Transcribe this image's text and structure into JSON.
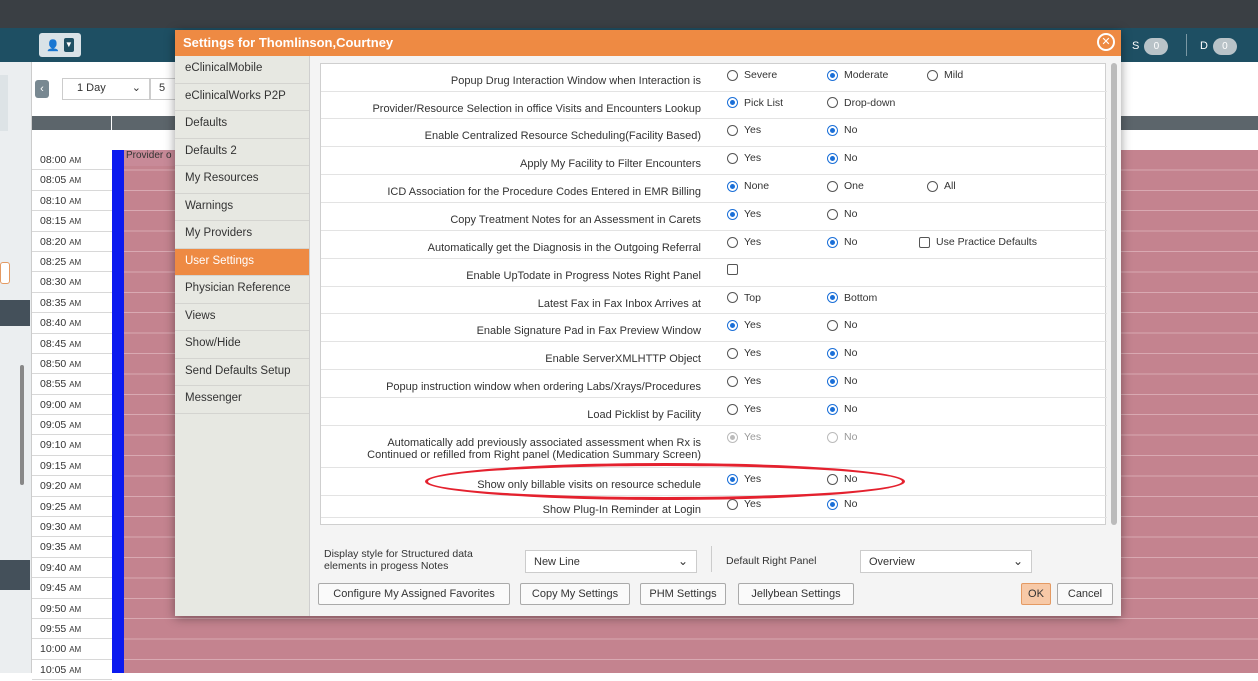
{
  "app": {
    "counters": [
      {
        "label": "S",
        "count": "0"
      },
      {
        "label": "D",
        "count": "0"
      }
    ]
  },
  "schedule": {
    "view": "1 Day",
    "view_count": "5",
    "provider_stub": "Provider o",
    "times": [
      {
        "t": "08:00",
        "p": "AM"
      },
      {
        "t": "08:05",
        "p": "AM"
      },
      {
        "t": "08:10",
        "p": "AM"
      },
      {
        "t": "08:15",
        "p": "AM"
      },
      {
        "t": "08:20",
        "p": "AM"
      },
      {
        "t": "08:25",
        "p": "AM"
      },
      {
        "t": "08:30",
        "p": "AM"
      },
      {
        "t": "08:35",
        "p": "AM"
      },
      {
        "t": "08:40",
        "p": "AM"
      },
      {
        "t": "08:45",
        "p": "AM"
      },
      {
        "t": "08:50",
        "p": "AM"
      },
      {
        "t": "08:55",
        "p": "AM"
      },
      {
        "t": "09:00",
        "p": "AM"
      },
      {
        "t": "09:05",
        "p": "AM"
      },
      {
        "t": "09:10",
        "p": "AM"
      },
      {
        "t": "09:15",
        "p": "AM"
      },
      {
        "t": "09:20",
        "p": "AM"
      },
      {
        "t": "09:25",
        "p": "AM"
      },
      {
        "t": "09:30",
        "p": "AM"
      },
      {
        "t": "09:35",
        "p": "AM"
      },
      {
        "t": "09:40",
        "p": "AM"
      },
      {
        "t": "09:45",
        "p": "AM"
      },
      {
        "t": "09:50",
        "p": "AM"
      },
      {
        "t": "09:55",
        "p": "AM"
      },
      {
        "t": "10:00",
        "p": "AM"
      },
      {
        "t": "10:05",
        "p": "AM"
      }
    ]
  },
  "modal": {
    "title": "Settings for Thomlinson,Courtney",
    "nav": [
      {
        "label": "eClinicalMobile",
        "active": false
      },
      {
        "label": "eClinicalWorks P2P",
        "active": false
      },
      {
        "label": "Defaults",
        "active": false
      },
      {
        "label": "Defaults 2",
        "active": false
      },
      {
        "label": "My Resources",
        "active": false
      },
      {
        "label": "Warnings",
        "active": false
      },
      {
        "label": "My Providers",
        "active": false
      },
      {
        "label": "User Settings",
        "active": true
      },
      {
        "label": "Physician Reference",
        "active": false
      },
      {
        "label": "Views",
        "active": false
      },
      {
        "label": "Show/Hide",
        "active": false
      },
      {
        "label": "Send Defaults Setup",
        "active": false
      },
      {
        "label": "Messenger",
        "active": false
      }
    ],
    "settings": [
      {
        "label": "Popup Drug Interaction Window when Interaction is",
        "options": [
          {
            "label": "Severe",
            "checked": false
          },
          {
            "label": "Moderate",
            "checked": true
          },
          {
            "label": "Mild",
            "checked": false
          }
        ]
      },
      {
        "label": "Provider/Resource Selection in office Visits and Encounters Lookup",
        "options": [
          {
            "label": "Pick List",
            "checked": true
          },
          {
            "label": "Drop-down",
            "checked": false
          }
        ]
      },
      {
        "label": "Enable Centralized Resource Scheduling(Facility Based)",
        "options": [
          {
            "label": "Yes",
            "checked": false
          },
          {
            "label": "No",
            "checked": true
          }
        ]
      },
      {
        "label": "Apply My Facility to Filter Encounters",
        "options": [
          {
            "label": "Yes",
            "checked": false
          },
          {
            "label": "No",
            "checked": true
          }
        ]
      },
      {
        "label": "ICD Association for the Procedure Codes Entered in EMR Billing",
        "options": [
          {
            "label": "None",
            "checked": true
          },
          {
            "label": "One",
            "checked": false
          },
          {
            "label": "All",
            "checked": false
          }
        ]
      },
      {
        "label": "Copy Treatment Notes for an Assessment in Carets",
        "options": [
          {
            "label": "Yes",
            "checked": true
          },
          {
            "label": "No",
            "checked": false
          }
        ]
      },
      {
        "label": "Automatically get the Diagnosis in the Outgoing Referral",
        "options": [
          {
            "label": "Yes",
            "checked": false
          },
          {
            "label": "No",
            "checked": true
          }
        ],
        "checkbox": {
          "label": "Use Practice Defaults",
          "checked": false
        }
      },
      {
        "label": "Enable UpTodate in Progress Notes Right Panel",
        "options": [],
        "checkbox": {
          "label": "",
          "checked": false
        }
      },
      {
        "label": "Latest Fax in Fax Inbox Arrives at",
        "options": [
          {
            "label": "Top",
            "checked": false
          },
          {
            "label": "Bottom",
            "checked": true
          }
        ]
      },
      {
        "label": "Enable Signature Pad in Fax Preview Window",
        "options": [
          {
            "label": "Yes",
            "checked": true
          },
          {
            "label": "No",
            "checked": false
          }
        ]
      },
      {
        "label": "Enable ServerXMLHTTP Object",
        "options": [
          {
            "label": "Yes",
            "checked": false
          },
          {
            "label": "No",
            "checked": true
          }
        ]
      },
      {
        "label": "Popup instruction window when ordering Labs/Xrays/Procedures",
        "options": [
          {
            "label": "Yes",
            "checked": false
          },
          {
            "label": "No",
            "checked": true
          }
        ]
      },
      {
        "label": "Load Picklist by Facility",
        "options": [
          {
            "label": "Yes",
            "checked": false
          },
          {
            "label": "No",
            "checked": true
          }
        ]
      },
      {
        "label": "Automatically add previously associated assessment when Rx is",
        "label2": "Continued or refilled from Right panel (Medication Summary Screen)",
        "disabled": true,
        "options": [
          {
            "label": "Yes",
            "checked": true
          },
          {
            "label": "No",
            "checked": false
          }
        ]
      },
      {
        "label": "Show only billable visits on resource schedule",
        "options": [
          {
            "label": "Yes",
            "checked": true
          },
          {
            "label": "No",
            "checked": false
          }
        ]
      },
      {
        "label": "Show Plug-In Reminder at Login",
        "options": [
          {
            "label": "Yes",
            "checked": false
          },
          {
            "label": "No",
            "checked": true
          }
        ]
      }
    ],
    "display_style": {
      "label": "Display style for Structured data elements in progess Notes",
      "value": "New Line"
    },
    "right_panel": {
      "label": "Default Right Panel",
      "value": "Overview"
    },
    "buttons": {
      "configure": "Configure My Assigned Favorites",
      "copy": "Copy My Settings",
      "phm": "PHM Settings",
      "jellybean": "Jellybean Settings",
      "ok": "OK",
      "cancel": "Cancel"
    },
    "colors": {
      "header": "#ee8a43",
      "accent": "#1a6fd8",
      "highlight_ellipse": "#e4212e"
    }
  }
}
